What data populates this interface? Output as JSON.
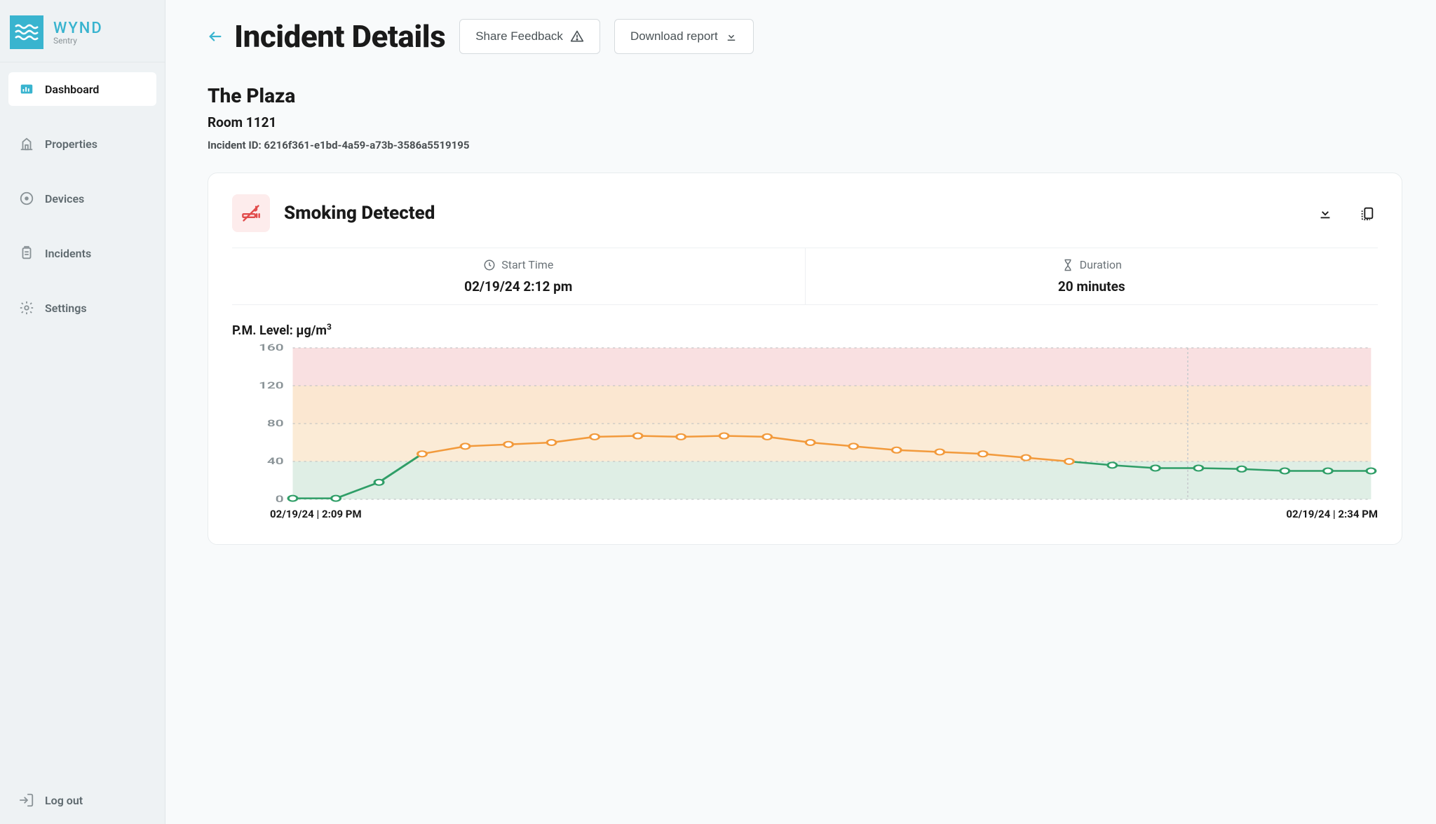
{
  "brand": {
    "name": "WYND",
    "sub": "Sentry"
  },
  "sidebar": {
    "items": [
      {
        "label": "Dashboard",
        "icon": "dashboard",
        "active": true
      },
      {
        "label": "Properties",
        "icon": "building",
        "active": false
      },
      {
        "label": "Devices",
        "icon": "device",
        "active": false
      },
      {
        "label": "Incidents",
        "icon": "clipboard",
        "active": false
      },
      {
        "label": "Settings",
        "icon": "gear",
        "active": false
      }
    ],
    "logout": "Log out"
  },
  "header": {
    "title": "Incident Details",
    "share_button": "Share Feedback",
    "download_button": "Download report"
  },
  "incident": {
    "property": "The Plaza",
    "room": "Room 1121",
    "id_label": "Incident ID: 6216f361-e1bd-4a59-a73b-3586a5519195",
    "alert_type": "Smoking Detected",
    "start_label": "Start Time",
    "start_value": "02/19/24 2:12 pm",
    "duration_label": "Duration",
    "duration_value": "20 minutes"
  },
  "chart_title": "P.M. Level: µg/m",
  "chart_superscript": "3",
  "chart_x_start": "02/19/24 | 2:09 PM",
  "chart_x_end": "02/19/24 | 2:34 PM",
  "chart_data": {
    "type": "line",
    "ylabel": "µg/m³",
    "ylim": [
      0,
      160
    ],
    "y_ticks": [
      0,
      40,
      80,
      120,
      160
    ],
    "x_start": "02/19/24 2:09 PM",
    "x_end": "02/19/24 2:34 PM",
    "bands": [
      {
        "from": 0,
        "to": 40,
        "color": "#dfeee5"
      },
      {
        "from": 40,
        "to": 80,
        "color": "#fbebd6"
      },
      {
        "from": 80,
        "to": 120,
        "color": "#fbe7d1"
      },
      {
        "from": 120,
        "to": 160,
        "color": "#f9e0e1"
      }
    ],
    "highlight_start_x_frac": 0.83,
    "series": [
      {
        "name": "pm_level",
        "color_low": "#2f9e67",
        "color_high": "#f29a3c",
        "threshold": 40,
        "values": [
          1,
          1,
          18,
          48,
          56,
          58,
          60,
          66,
          67,
          66,
          67,
          66,
          60,
          56,
          52,
          50,
          48,
          44,
          40,
          36,
          33,
          33,
          32,
          30,
          30,
          30
        ]
      }
    ]
  }
}
